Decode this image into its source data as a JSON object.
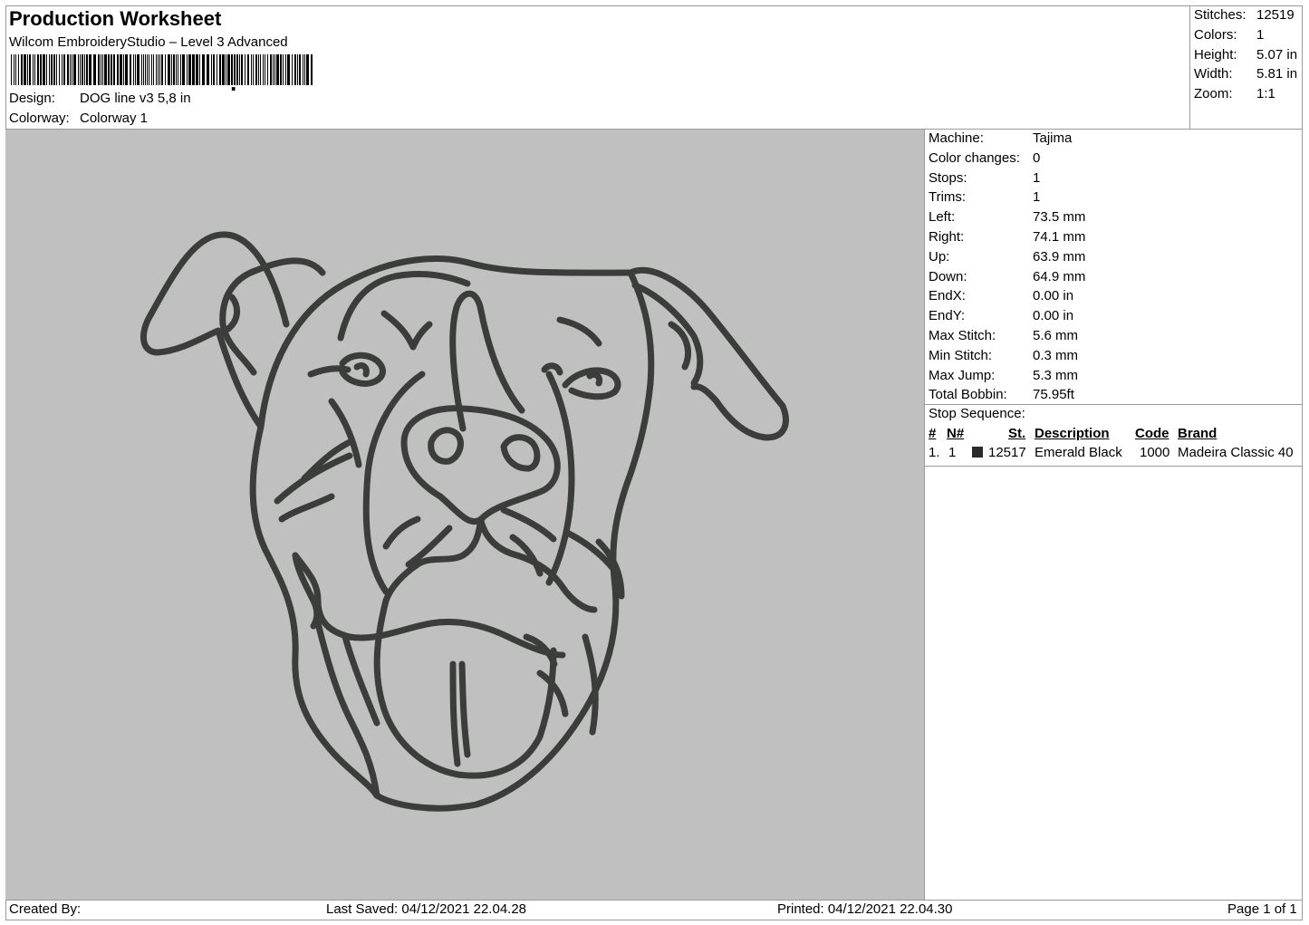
{
  "header": {
    "title": "Production Worksheet",
    "software": "Wilcom EmbroideryStudio – Level 3 Advanced",
    "design_label": "Design:",
    "design_value": "DOG line v3 5,8 in",
    "colorway_label": "Colorway:",
    "colorway_value": "Colorway 1"
  },
  "summary": [
    {
      "label": "Stitches:",
      "value": "12519"
    },
    {
      "label": "Colors:",
      "value": "1"
    },
    {
      "label": "Height:",
      "value": "5.07 in"
    },
    {
      "label": "Width:",
      "value": "5.81 in"
    },
    {
      "label": "Zoom:",
      "value": "1:1"
    }
  ],
  "machine_info": [
    {
      "label": "Machine:",
      "value": "Tajima"
    },
    {
      "label": "Color changes:",
      "value": "0"
    },
    {
      "label": "Stops:",
      "value": "1"
    },
    {
      "label": "Trims:",
      "value": "1"
    },
    {
      "label": "Left:",
      "value": "73.5 mm"
    },
    {
      "label": "Right:",
      "value": "74.1 mm"
    },
    {
      "label": "Up:",
      "value": "63.9 mm"
    },
    {
      "label": "Down:",
      "value": "64.9 mm"
    },
    {
      "label": "EndX:",
      "value": "0.00 in"
    },
    {
      "label": "EndY:",
      "value": "0.00 in"
    },
    {
      "label": "Max Stitch:",
      "value": "5.6 mm"
    },
    {
      "label": "Min Stitch:",
      "value": "0.3 mm"
    },
    {
      "label": "Max Jump:",
      "value": "5.3 mm"
    },
    {
      "label": "Total Bobbin:",
      "value": "75.95ft"
    }
  ],
  "stop_sequence": {
    "label": "Stop Sequence:",
    "columns": {
      "num": "#",
      "n": "N#",
      "st": "St.",
      "description": "Description",
      "code": "Code",
      "brand": "Brand"
    },
    "rows": [
      {
        "num": "1.",
        "n": "1",
        "color": "#2a2a2a",
        "st": "12517",
        "description": "Emerald Black",
        "code": "1000",
        "brand": "Madeira Classic 40"
      }
    ]
  },
  "footer": {
    "created_by": "Created By:",
    "last_saved": "Last Saved: 04/12/2021 22.04.28",
    "printed": "Printed: 04/12/2021 22.04.30",
    "page": "Page 1 of 1"
  },
  "design_preview": {
    "background": "#c0c0c0",
    "thread_color": "#3a3d3a"
  }
}
